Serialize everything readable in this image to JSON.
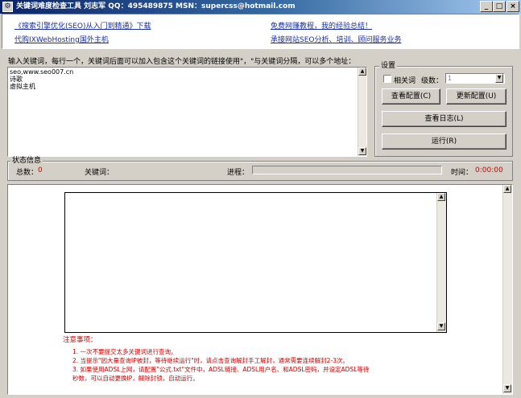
{
  "window": {
    "title": "关键词难度检查工具 刘志军 QQ：495489875 MSN：supercss@hotmail.com",
    "minimize_symbol": "_",
    "maximize_symbol": "□",
    "close_symbol": "×",
    "app_icon": "app-window-icon"
  },
  "header": {
    "links": [
      "《搜索引擎优化(SEO)从入门到精通》下载",
      "免费网赚教程，我的经验总结！",
      "代购IXWebHosting国外主机",
      "承接网站SEO分析、培训、顾问服务业务"
    ]
  },
  "input": {
    "instruction": "输入关键词，每行一个，关键词后面可以加入包含这个关键词的链接使用\"，\"与关键词分隔，可以多个地址：",
    "value": "seo,www.seo007.cn\n诗歌\n虚拟主机"
  },
  "settings": {
    "group_title": "设置",
    "related_label": "相关词",
    "level_label": "级数：",
    "level_value": "1",
    "buttons": {
      "view_config": "查看配置(C)",
      "update_config": "更新配置(U)",
      "view_log": "查看日志(L)",
      "run": "运行(R)"
    }
  },
  "status": {
    "group_title": "状态信息",
    "total_label": "总数：",
    "total_value": "0",
    "keyword_label": "关键词：",
    "progress_label": "进程：",
    "progress_value": 0,
    "time_label": "时间：",
    "time_value": "0:00:00"
  },
  "notes": {
    "title": "注意事项：",
    "items": [
      "1.   一次不要提交太多关键词进行查询。",
      "2.   当提示\"因大量查询IP被封，等待继续运行\"时，请点击查询解封手工解封，通常需要连续解封2-3次。",
      "3.   如果使用ADSL上网，请配置\"公式.txt\"文件中，ADSL链接、ADSL用户名、和ADSL密码，并设定ADSL等待",
      "      秒数，可以自动更换IP，解除封锁，自动运行。"
    ]
  },
  "colors": {
    "title_gradient_start": "#0a246a",
    "title_gradient_end": "#a6caf0",
    "link": "#1a2fa0",
    "status_value": "#d00000",
    "notes": "#d00000"
  }
}
